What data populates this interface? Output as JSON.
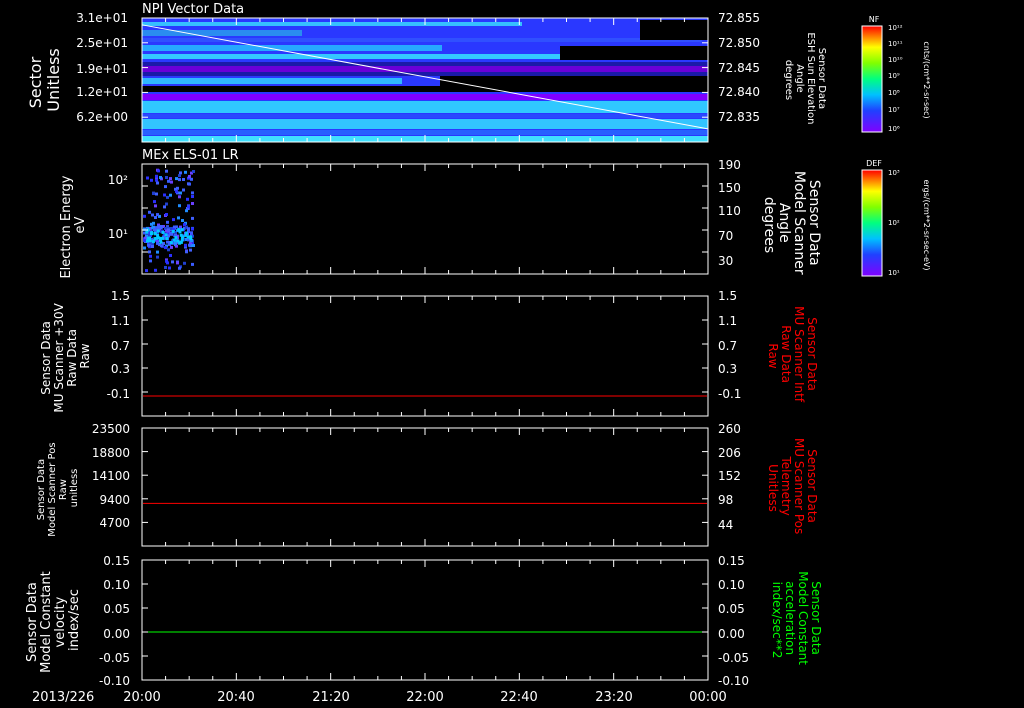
{
  "date_label": "2013/226",
  "time_ticks": [
    "20:00",
    "20:40",
    "21:20",
    "22:00",
    "22:40",
    "23:20",
    "00:00"
  ],
  "colors": {
    "red": "#ff0000",
    "green": "#00ff00",
    "white": "#ffffff"
  },
  "chart_data": [
    {
      "type": "heatmap",
      "title": "NPI Vector Data",
      "ylabel_lines": [
        "Sector",
        "Unitless"
      ],
      "yticks": [
        "3.1e+01",
        "2.5e+01",
        "1.9e+01",
        "1.2e+01",
        "6.2e+00"
      ],
      "right_axis_label_lines": [
        "Sensor Data",
        "ESH Sun Elevation",
        "Angle",
        "degrees"
      ],
      "right_ticks": [
        "72.855",
        "72.850",
        "72.845",
        "72.840",
        "72.835"
      ],
      "overlay_line": {
        "x": [
          "20:00",
          "00:00"
        ],
        "y": [
          72.8556,
          72.8342
        ]
      },
      "colorbar": {
        "label": "NF",
        "unit": "cnts/(cm**2-sr-sec)",
        "ticks": [
          "10¹²",
          "10¹¹",
          "10¹⁰",
          "10⁹",
          "10⁸",
          "10⁷",
          "10⁶"
        ]
      }
    },
    {
      "type": "heatmap",
      "title": "MEx ELS-01 LR",
      "ylabel_lines": [
        "Electron Energy",
        "eV"
      ],
      "yticks": [
        "10²",
        "10¹"
      ],
      "right_axis_label_lines": [
        "Sensor Data",
        "Model Scanner",
        "Angle",
        "degrees"
      ],
      "right_ticks": [
        "190",
        "150",
        "110",
        "70",
        "30"
      ],
      "colorbar": {
        "label": "DEF",
        "unit": "ergs/(cm**2-sr-sec-eV)",
        "ticks": [
          "10³",
          "10²",
          "10¹"
        ]
      }
    },
    {
      "type": "line",
      "ylabel_lines": [
        "Sensor Data",
        "MU Scanner +30V",
        "Raw Data",
        "Raw"
      ],
      "yticks": [
        "1.5",
        "1.1",
        "0.7",
        "0.3",
        "-0.1"
      ],
      "right_axis_label_lines": [
        "Sensor Data",
        "MU Scanner Intf",
        "Raw Data",
        "Raw"
      ],
      "right_ticks": [
        "1.5",
        "1.1",
        "0.7",
        "0.3",
        "-0.1"
      ],
      "ylim": [
        -0.3,
        1.5
      ],
      "series": [
        {
          "x": [
            "20:00",
            "00:00"
          ],
          "values": [
            0.0,
            0.0
          ]
        }
      ]
    },
    {
      "type": "line",
      "ylabel_lines": [
        "Sensor Data",
        "Model Scanner Pos",
        "Raw",
        "unitless"
      ],
      "yticks": [
        "23500",
        "18800",
        "14100",
        "9400",
        "4700"
      ],
      "right_axis_label_lines": [
        "Sensor Data",
        "MU Scanner Pos",
        "Telemetry",
        "Unitless"
      ],
      "right_ticks": [
        "260",
        "206",
        "152",
        "98",
        "44"
      ],
      "ylim": [
        0,
        23500
      ],
      "series": [
        {
          "x": [
            "20:00",
            "00:00"
          ],
          "values": [
            8500,
            8500
          ]
        }
      ]
    },
    {
      "type": "line",
      "ylabel_lines": [
        "Sensor Data",
        "Model Constant",
        "velocity",
        "index/sec"
      ],
      "yticks": [
        "0.15",
        "0.10",
        "0.05",
        "0.00",
        "-0.05",
        "-0.10"
      ],
      "right_axis_label_lines": [
        "Sensor Data",
        "Model Constant",
        "acceleration",
        "index/sec**2"
      ],
      "right_ticks": [
        "0.15",
        "0.10",
        "0.05",
        "0.00",
        "-0.05",
        "-0.10"
      ],
      "ylim": [
        -0.1,
        0.15
      ],
      "series": [
        {
          "x": [
            "20:00",
            "00:00"
          ],
          "values": [
            0.0,
            0.0
          ]
        }
      ]
    }
  ]
}
